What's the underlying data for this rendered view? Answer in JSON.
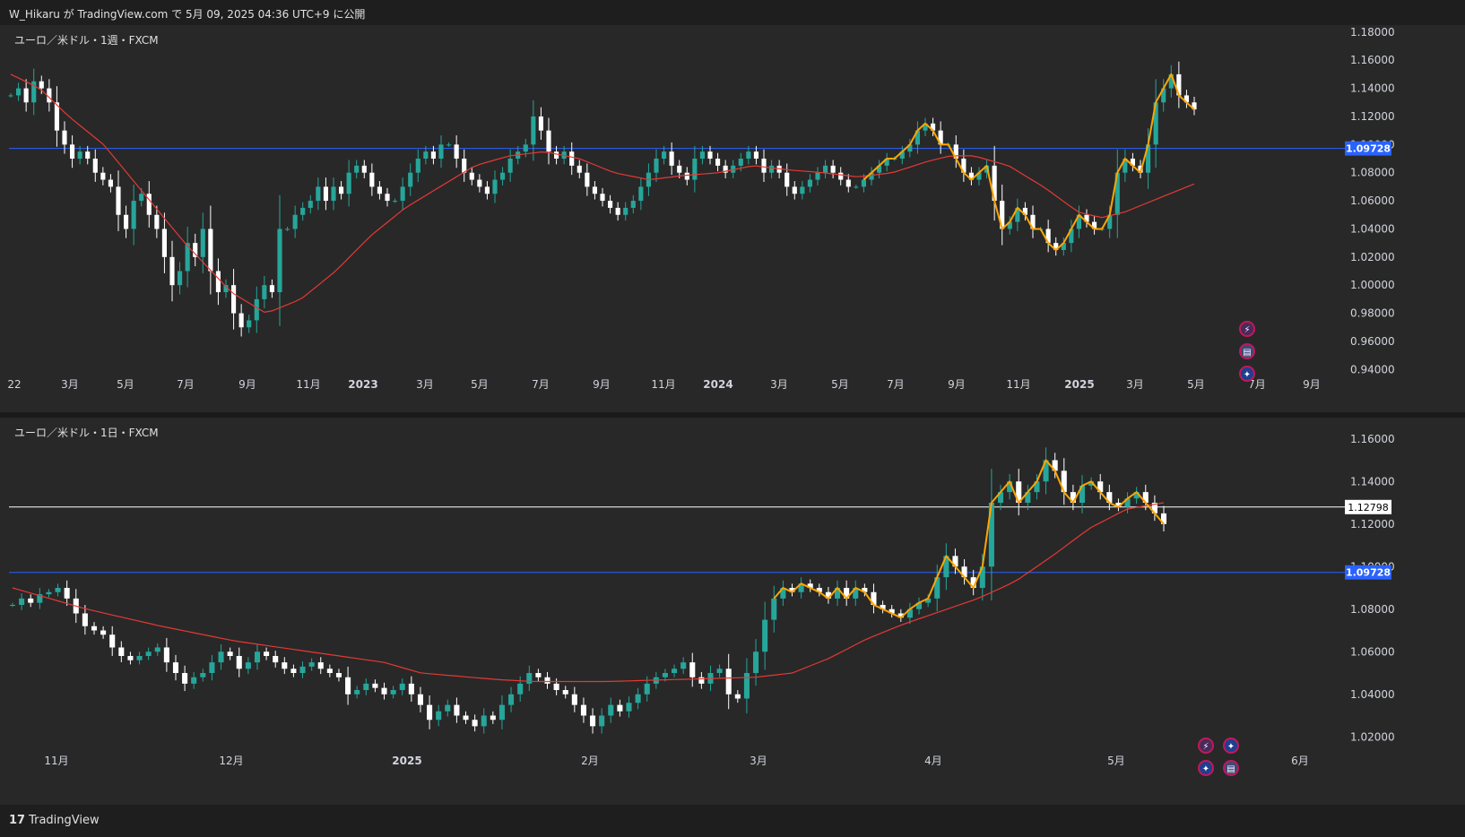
{
  "header": {
    "publish_text": "W_Hikaru が TradingView.com で 5月 09, 2025 04:36 UTC+9 に公開"
  },
  "footer": {
    "brand": "TradingView",
    "brand_mark": "17"
  },
  "colors": {
    "bg": "#282828",
    "up": "#26a69a",
    "down": "#ffffff",
    "ma": "#e53935",
    "hline": "#2962ff",
    "drawing": "#ffa500",
    "price_line": "#ffffff"
  },
  "panels": [
    {
      "title": "ユーロ／米ドル・1週・FXCM",
      "y_labels": [
        "1.18000",
        "1.16000",
        "1.14000",
        "1.12000",
        "1.10000",
        "1.08000",
        "1.06000",
        "1.04000",
        "1.02000",
        "1.00000",
        "0.98000",
        "0.96000",
        "0.94000"
      ],
      "y_ticks": [
        1.18,
        1.16,
        1.14,
        1.12,
        1.1,
        1.08,
        1.06,
        1.04,
        1.02,
        1.0,
        0.98,
        0.96,
        0.94
      ],
      "x_labels": [
        "22",
        "3月",
        "5月",
        "7月",
        "9月",
        "11月",
        "2023",
        "3月",
        "5月",
        "7月",
        "9月",
        "11月",
        "2024",
        "3月",
        "5月",
        "7月",
        "9月",
        "11月",
        "2025",
        "3月",
        "5月",
        "7月",
        "9月"
      ],
      "x_bold": [
        "2023",
        "2024",
        "2025"
      ],
      "hline": {
        "value": 1.09728,
        "label": "1.09728"
      },
      "icons": [
        "lightning-icon",
        "us-flag-icon",
        "eu-flag-icon"
      ]
    },
    {
      "title": "ユーロ／米ドル・1日・FXCM",
      "y_labels": [
        "1.16000",
        "1.14000",
        "1.12000",
        "1.10000",
        "1.08000",
        "1.06000",
        "1.04000",
        "1.02000"
      ],
      "y_ticks": [
        1.16,
        1.14,
        1.12,
        1.1,
        1.08,
        1.06,
        1.04,
        1.02
      ],
      "x_labels": [
        "11月",
        "12月",
        "2025",
        "2月",
        "3月",
        "4月",
        "5月",
        "6月"
      ],
      "x_bold": [
        "2025"
      ],
      "hline": {
        "value": 1.09728,
        "label": "1.09728"
      },
      "price_line": {
        "value": 1.12798,
        "label": "1.12798"
      },
      "icons": [
        "lightning-icon",
        "eu-flag-icon",
        "eu-flag-icon",
        "us-flag-icon"
      ]
    }
  ],
  "chart_data": [
    {
      "type": "candlestick",
      "title": "ユーロ／米ドル・1週・FXCM",
      "ylim": [
        0.93,
        1.185
      ],
      "ma_trend": [
        [
          0,
          1.15
        ],
        [
          5,
          1.14
        ],
        [
          10,
          1.12
        ],
        [
          16,
          1.1
        ],
        [
          22,
          1.07
        ],
        [
          30,
          1.03
        ],
        [
          38,
          0.995
        ],
        [
          44,
          0.98
        ],
        [
          50,
          0.99
        ],
        [
          56,
          1.01
        ],
        [
          62,
          1.035
        ],
        [
          68,
          1.055
        ],
        [
          74,
          1.07
        ],
        [
          80,
          1.085
        ],
        [
          86,
          1.092
        ],
        [
          92,
          1.095
        ],
        [
          98,
          1.09
        ],
        [
          104,
          1.08
        ],
        [
          110,
          1.075
        ],
        [
          116,
          1.078
        ],
        [
          122,
          1.08
        ],
        [
          128,
          1.085
        ],
        [
          134,
          1.082
        ],
        [
          140,
          1.08
        ],
        [
          146,
          1.077
        ],
        [
          152,
          1.08
        ],
        [
          158,
          1.088
        ],
        [
          162,
          1.092
        ],
        [
          166,
          1.092
        ],
        [
          172,
          1.085
        ],
        [
          178,
          1.07
        ],
        [
          184,
          1.052
        ],
        [
          188,
          1.048
        ],
        [
          192,
          1.052
        ],
        [
          198,
          1.062
        ],
        [
          204,
          1.072
        ]
      ],
      "closes": [
        1.135,
        1.14,
        1.13,
        1.145,
        1.14,
        1.13,
        1.11,
        1.1,
        1.09,
        1.095,
        1.09,
        1.08,
        1.075,
        1.07,
        1.05,
        1.04,
        1.06,
        1.065,
        1.05,
        1.04,
        1.02,
        1.0,
        1.01,
        1.03,
        1.02,
        1.04,
        1.01,
        0.995,
        1.0,
        0.98,
        0.97,
        0.975,
        0.99,
        1.0,
        0.995,
        1.04,
        1.04,
        1.05,
        1.055,
        1.06,
        1.07,
        1.06,
        1.07,
        1.065,
        1.08,
        1.085,
        1.08,
        1.07,
        1.065,
        1.06,
        1.06,
        1.07,
        1.08,
        1.09,
        1.095,
        1.09,
        1.1,
        1.1,
        1.09,
        1.08,
        1.075,
        1.07,
        1.065,
        1.075,
        1.08,
        1.09,
        1.095,
        1.1,
        1.12,
        1.11,
        1.095,
        1.09,
        1.095,
        1.085,
        1.08,
        1.07,
        1.065,
        1.06,
        1.055,
        1.05,
        1.055,
        1.06,
        1.07,
        1.08,
        1.09,
        1.095,
        1.085,
        1.08,
        1.075,
        1.09,
        1.095,
        1.09,
        1.085,
        1.08,
        1.085,
        1.09,
        1.095,
        1.09,
        1.08,
        1.085,
        1.08,
        1.07,
        1.065,
        1.07,
        1.075,
        1.08,
        1.085,
        1.08,
        1.075,
        1.07,
        1.07,
        1.075,
        1.08,
        1.085,
        1.09,
        1.09,
        1.095,
        1.1,
        1.11,
        1.115,
        1.11,
        1.1,
        1.1,
        1.09,
        1.08,
        1.075,
        1.08,
        1.085,
        1.06,
        1.04,
        1.045,
        1.055,
        1.05,
        1.04,
        1.04,
        1.03,
        1.025,
        1.03,
        1.04,
        1.05,
        1.045,
        1.04,
        1.04,
        1.05,
        1.08,
        1.09,
        1.085,
        1.08,
        1.1,
        1.13,
        1.14,
        1.15,
        1.135,
        1.13,
        1.125
      ]
    },
    {
      "type": "candlestick",
      "title": "ユーロ／米ドル・1日・FXCM",
      "ylim": [
        1.01,
        1.17
      ],
      "ma_trend": [
        [
          0,
          1.09
        ],
        [
          20,
          1.08
        ],
        [
          40,
          1.072
        ],
        [
          60,
          1.065
        ],
        [
          80,
          1.06
        ],
        [
          100,
          1.055
        ],
        [
          110,
          1.05
        ],
        [
          130,
          1.047
        ],
        [
          140,
          1.046
        ],
        [
          160,
          1.046
        ],
        [
          180,
          1.047
        ],
        [
          200,
          1.048
        ],
        [
          210,
          1.05
        ],
        [
          220,
          1.057
        ],
        [
          230,
          1.066
        ],
        [
          240,
          1.073
        ],
        [
          250,
          1.079
        ],
        [
          260,
          1.085
        ],
        [
          270,
          1.093
        ],
        [
          280,
          1.105
        ],
        [
          290,
          1.118
        ],
        [
          300,
          1.127
        ],
        [
          310,
          1.13
        ]
      ],
      "closes": [
        1.082,
        1.085,
        1.083,
        1.087,
        1.088,
        1.09,
        1.085,
        1.078,
        1.072,
        1.07,
        1.068,
        1.062,
        1.058,
        1.056,
        1.058,
        1.06,
        1.062,
        1.055,
        1.05,
        1.045,
        1.048,
        1.05,
        1.055,
        1.06,
        1.058,
        1.052,
        1.055,
        1.06,
        1.058,
        1.055,
        1.052,
        1.05,
        1.053,
        1.055,
        1.052,
        1.05,
        1.048,
        1.04,
        1.042,
        1.045,
        1.043,
        1.04,
        1.042,
        1.045,
        1.04,
        1.035,
        1.028,
        1.032,
        1.035,
        1.03,
        1.028,
        1.025,
        1.03,
        1.028,
        1.035,
        1.04,
        1.045,
        1.05,
        1.048,
        1.045,
        1.042,
        1.04,
        1.035,
        1.03,
        1.025,
        1.03,
        1.035,
        1.032,
        1.036,
        1.04,
        1.045,
        1.048,
        1.05,
        1.052,
        1.055,
        1.048,
        1.045,
        1.05,
        1.052,
        1.04,
        1.038,
        1.05,
        1.06,
        1.075,
        1.085,
        1.09,
        1.088,
        1.092,
        1.09,
        1.088,
        1.085,
        1.09,
        1.085,
        1.09,
        1.088,
        1.082,
        1.08,
        1.078,
        1.076,
        1.08,
        1.083,
        1.085,
        1.095,
        1.105,
        1.1,
        1.095,
        1.09,
        1.1,
        1.13,
        1.135,
        1.14,
        1.13,
        1.135,
        1.14,
        1.15,
        1.145,
        1.135,
        1.13,
        1.138,
        1.14,
        1.135,
        1.13,
        1.128,
        1.132,
        1.135,
        1.13,
        1.125,
        1.12
      ]
    }
  ]
}
